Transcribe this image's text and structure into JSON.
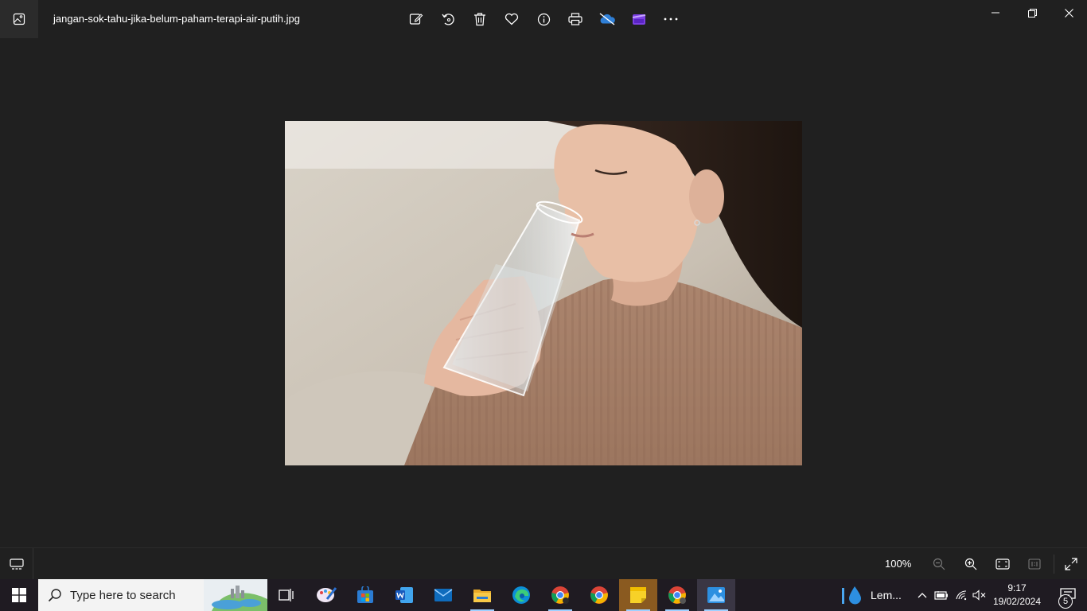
{
  "window": {
    "filename": "jangan-sok-tahu-jika-belum-paham-terapi-air-putih.jpg",
    "app_icon": "photos-app-icon",
    "toolbar": [
      {
        "name": "edit-image-button",
        "icon": "edit-icon"
      },
      {
        "name": "rotate-button",
        "icon": "rotate-icon"
      },
      {
        "name": "delete-button",
        "icon": "trash-icon"
      },
      {
        "name": "favorite-button",
        "icon": "heart-icon"
      },
      {
        "name": "file-info-button",
        "icon": "info-icon"
      },
      {
        "name": "print-button",
        "icon": "printer-icon"
      },
      {
        "name": "onedrive-button",
        "icon": "cloud-off-icon"
      },
      {
        "name": "clipchamp-button",
        "icon": "clipchamp-icon"
      },
      {
        "name": "more-options-button",
        "icon": "ellipsis-icon"
      }
    ],
    "controls": [
      "minimize",
      "restore",
      "close"
    ]
  },
  "bottombar": {
    "zoom_level": "100%",
    "accent": "#ffffff"
  },
  "taskbar": {
    "search_placeholder": "Type here to search",
    "pinned": [
      "task-view",
      "paint",
      "microsoft-store",
      "word",
      "mail",
      "file-explorer",
      "edge",
      "chrome-profile-a",
      "chrome",
      "sticky-notes",
      "chrome-profile-b",
      "photos"
    ],
    "tray_app_label": "Lem...",
    "time": "9:17",
    "date": "19/02/2024",
    "notification_count": "5",
    "colors": {
      "taskbar_bg": "#1f1b22",
      "active_app": "#3a3644",
      "sticky_notes_bg": "#8a5a20"
    }
  }
}
